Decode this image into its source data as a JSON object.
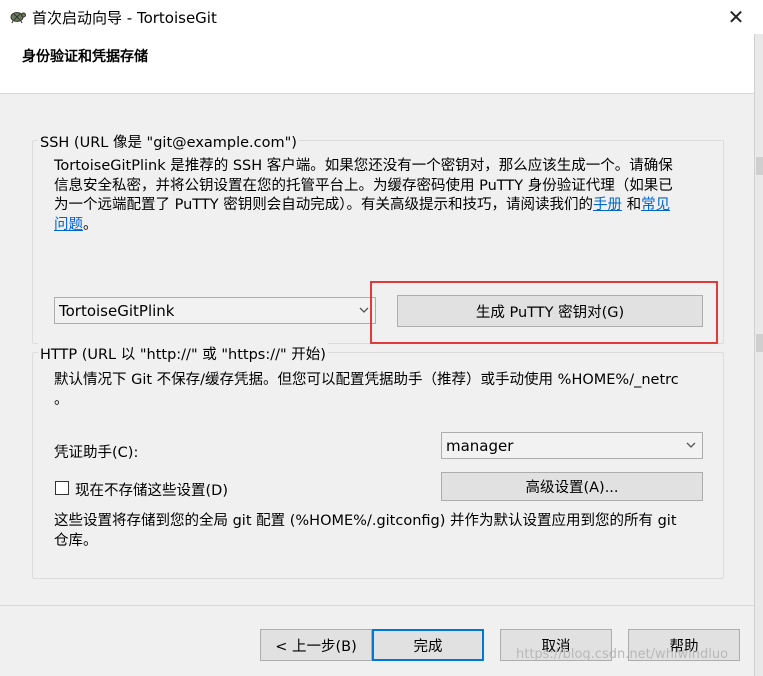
{
  "window": {
    "title": "首次启动向导 - TortoiseGit",
    "close_symbol": "✕",
    "icon": "tortoise-icon"
  },
  "header": {
    "title": "身份验证和凭据存储"
  },
  "ssh": {
    "group_label": "SSH (URL 像是 \"git@example.com\")",
    "desc_line1": "TortoiseGitPlink 是推荐的 SSH 客户端。如果您还没有一个密钥对，那么应该生成一个。请确保",
    "desc_line2": "信息安全私密，并将公钥设置在您的托管平台上。为缓存密码使用 PuTTY 身份验证代理（如果已",
    "desc_line3": "为一个远端配置了 PuTTY 密钥则会自动完成）。有关高级提示和技巧，请阅读我们的",
    "link_manual": "手册",
    "and_text": " 和",
    "link_faq_part1": "常见",
    "link_faq_part2": "问题",
    "desc_end": "。",
    "client_select": "TortoiseGitPlink",
    "generate_button": "生成 PuTTY 密钥对(G)"
  },
  "http": {
    "group_label": "HTTP (URL 以 \"http://\" 或 \"https://\" 开始)",
    "desc_line1": "默认情况下 Git 不保存/缓存凭据。但您可以配置凭据助手（推荐）或手动使用 %HOME%/_netrc",
    "desc_line2": "。",
    "helper_label": "凭证助手(C):",
    "helper_select": "manager",
    "dont_store_label": "现在不存储这些设置(D)",
    "dont_store_checked": false,
    "advanced_button": "高级设置(A)...",
    "note_line1": "这些设置将存储到您的全局 git 配置 (%HOME%/.gitconfig) 并作为默认设置应用到您的所有 git",
    "note_line2": "仓库。"
  },
  "footer": {
    "back_button": "< 上一步(B)",
    "finish_button": "完成",
    "cancel_button": "取消",
    "help_button": "帮助"
  },
  "watermark": "https://blog.csdn.net/whiwindluo",
  "colors": {
    "link": "#0066cc",
    "highlight": "#e03a3a",
    "focus": "#0078d7"
  }
}
